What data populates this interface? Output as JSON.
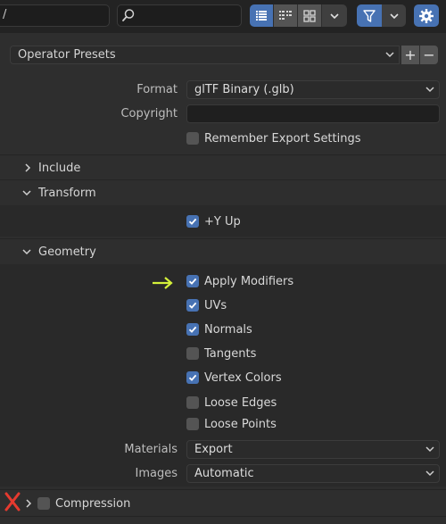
{
  "toolbar": {
    "path_value": "/",
    "search_placeholder": "",
    "view_buttons": [
      "vertical-list",
      "horizontal-list",
      "thumbnails"
    ]
  },
  "presets": {
    "label": "Operator Presets",
    "add": "+",
    "remove": "−"
  },
  "main": {
    "format_label": "Format",
    "format_value": "glTF Binary (.glb)",
    "copyright_label": "Copyright",
    "copyright_value": "",
    "remember_label": "Remember Export Settings",
    "remember_checked": false
  },
  "sections": {
    "include": {
      "label": "Include",
      "expanded": false
    },
    "transform": {
      "label": "Transform",
      "expanded": true,
      "yup_label": "+Y Up",
      "yup_checked": true
    },
    "geometry": {
      "label": "Geometry",
      "expanded": true,
      "options": [
        {
          "label": "Apply Modifiers",
          "checked": true
        },
        {
          "label": "UVs",
          "checked": true
        },
        {
          "label": "Normals",
          "checked": true
        },
        {
          "label": "Tangents",
          "checked": false
        },
        {
          "label": "Vertex Colors",
          "checked": true
        },
        {
          "label": "Loose Edges",
          "checked": false
        },
        {
          "label": "Loose Points",
          "checked": false
        }
      ],
      "materials_label": "Materials",
      "materials_value": "Export",
      "images_label": "Images",
      "images_value": "Automatic"
    },
    "compression": {
      "label": "Compression",
      "checked": false,
      "expanded": false
    }
  },
  "annotations": {
    "arrow_color": "#d4f03a",
    "x_mark_color": "#e53a2f"
  },
  "colors": {
    "accent": "#4772b3",
    "background": "#2e2e2e"
  }
}
